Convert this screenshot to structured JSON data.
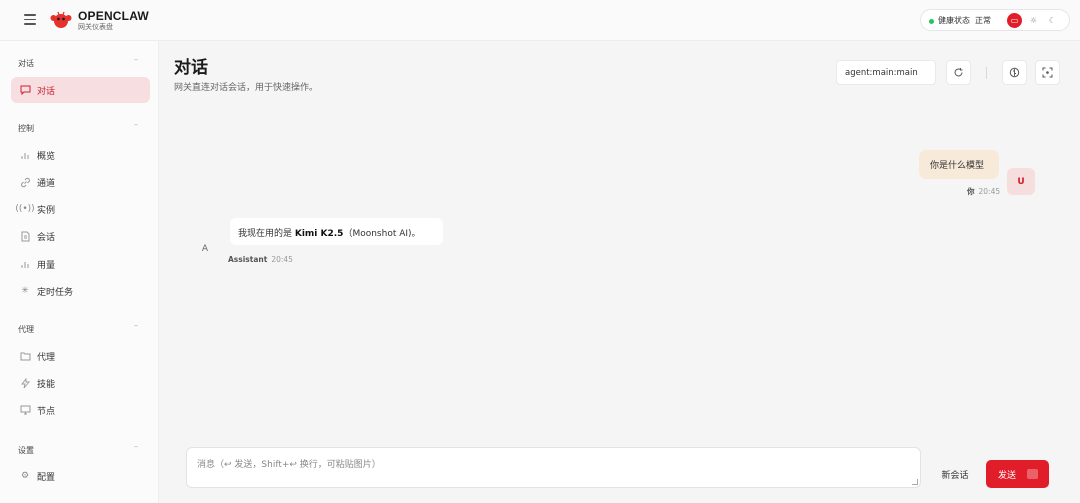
{
  "header": {
    "brand_name": "OPENCLAW",
    "brand_sub": "网关仪表盘",
    "health_label": "健康状态",
    "health_value": "正常",
    "status_color": "#22c55e",
    "accent_color": "#e11d2a"
  },
  "sidebar": {
    "sections": [
      {
        "title": "对话",
        "items": [
          {
            "label": "对话",
            "icon": "chat-bubble-icon",
            "active": true
          }
        ]
      },
      {
        "title": "控制",
        "items": [
          {
            "label": "概览",
            "icon": "bar-chart-icon"
          },
          {
            "label": "通道",
            "icon": "link-icon"
          },
          {
            "label": "实例",
            "icon": "radio-icon"
          },
          {
            "label": "会话",
            "icon": "document-icon"
          },
          {
            "label": "用量",
            "icon": "bar-chart-icon"
          },
          {
            "label": "定时任务",
            "icon": "spinner-icon"
          }
        ]
      },
      {
        "title": "代理",
        "items": [
          {
            "label": "代理",
            "icon": "folder-icon"
          },
          {
            "label": "技能",
            "icon": "lightning-icon"
          },
          {
            "label": "节点",
            "icon": "monitor-icon"
          }
        ]
      },
      {
        "title": "设置",
        "items": [
          {
            "label": "配置",
            "icon": "gear-icon"
          }
        ]
      }
    ]
  },
  "main": {
    "title": "对话",
    "subtitle": "网关直连对话会话，用于快速操作。",
    "session_key": "agent:main:main"
  },
  "messages": {
    "user": {
      "text": "你是什么模型",
      "sender": "你",
      "time": "20:45",
      "avatar": "U"
    },
    "assistant": {
      "prefix": "我现在用的是 ",
      "model": "Kimi K2.5",
      "suffix": "（Moonshot AI)。",
      "sender": "Assistant",
      "time": "20:45",
      "avatar": "A"
    }
  },
  "composer": {
    "placeholder": "消息（↩ 发送，Shift+↩ 换行，可粘贴图片）",
    "new_chat_label": "新会话",
    "send_label": "发送"
  }
}
